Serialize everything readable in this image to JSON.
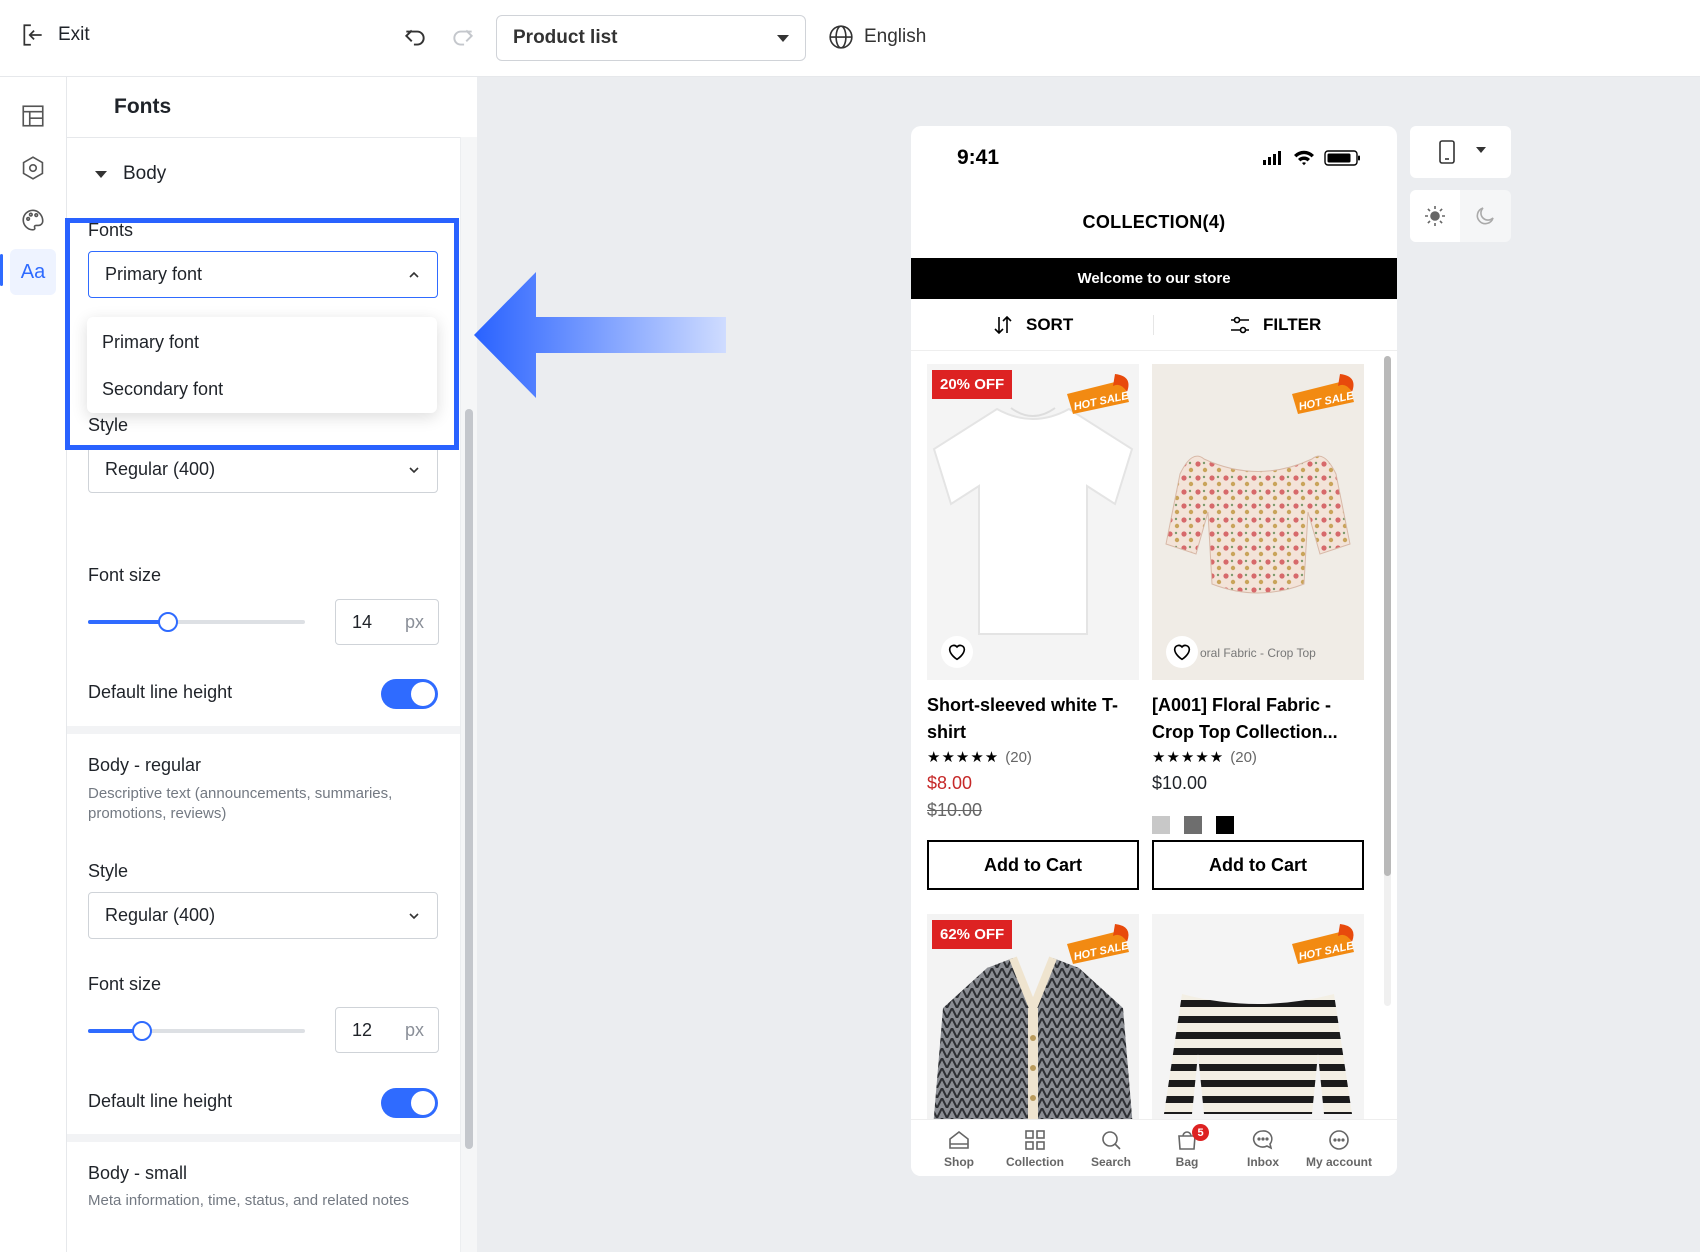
{
  "topbar": {
    "exit_label": "Exit",
    "page_select": "Product list",
    "language": "English"
  },
  "rail": {
    "items": [
      "layout-icon",
      "settings-icon",
      "palette-icon",
      "typography-icon"
    ],
    "active": "Aa"
  },
  "panel": {
    "title": "Fonts",
    "section": "Body",
    "fonts_label": "Fonts",
    "fonts_selected": "Primary font",
    "fonts_options": [
      "Primary font",
      "Secondary font"
    ],
    "body": {
      "style_label": "Style",
      "style_value": "Regular (400)",
      "size_label": "Font size",
      "size_value": "14",
      "size_unit": "px",
      "size_fraction": 0.37,
      "line_height_label": "Default line height",
      "line_height_on": true
    },
    "body_regular": {
      "title": "Body - regular",
      "desc": "Descriptive text (announcements, summaries, promotions, reviews)",
      "style_label": "Style",
      "style_value": "Regular (400)",
      "size_label": "Font size",
      "size_value": "12",
      "size_unit": "px",
      "size_fraction": 0.25,
      "line_height_label": "Default line height",
      "line_height_on": true
    },
    "body_small": {
      "title": "Body - small",
      "desc": "Meta information, time, status, and related notes"
    }
  },
  "phone": {
    "time": "9:41",
    "collection_title": "COLLECTION(4)",
    "welcome": "Welcome to our store",
    "sort_label": "SORT",
    "filter_label": "FILTER",
    "products": [
      {
        "badge": "20% OFF",
        "name": "Short-sleeved white T-shirt",
        "stars": "★★★★★",
        "reviews": "(20)",
        "price": "$8.00",
        "old_price": "$10.00",
        "cart": "Add to Cart"
      },
      {
        "badge": "",
        "caption": "oral Fabric - Crop Top",
        "name": "[A001] Floral Fabric - Crop Top Collection...",
        "stars": "★★★★★",
        "reviews": "(20)",
        "price": "$10.00",
        "swatches": [
          "#c8c8c8",
          "#6e6e6e",
          "#000000"
        ],
        "cart": "Add to Cart"
      },
      {
        "badge": "62% OFF"
      },
      {
        "badge": ""
      }
    ],
    "hot_sale": "HOT SALE",
    "nav": [
      {
        "label": "Shop"
      },
      {
        "label": "Collection"
      },
      {
        "label": "Search"
      },
      {
        "label": "Bag",
        "badge": "5"
      },
      {
        "label": "Inbox"
      },
      {
        "label": "My account"
      }
    ]
  },
  "colors": {
    "accent": "#2f6bff",
    "highlight": "#2962ff",
    "sale": "#c62828",
    "badge": "#dd2222"
  }
}
